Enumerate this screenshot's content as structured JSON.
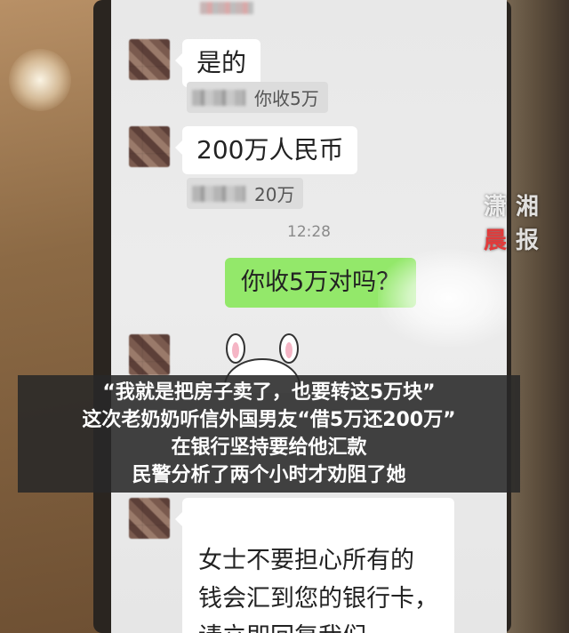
{
  "watermark": {
    "line1": [
      "潇",
      "湘"
    ],
    "line2": [
      "晨",
      "报"
    ]
  },
  "chat": {
    "messages": [
      {
        "type": "received",
        "text": "是的",
        "quote": "你收5万"
      },
      {
        "type": "received",
        "text": "200万人民币",
        "quote": "20万"
      },
      {
        "type": "timestamp",
        "text": "12:28"
      },
      {
        "type": "sent",
        "text": "你收5万对吗？"
      },
      {
        "type": "received",
        "sticker": "bunny-sticker"
      },
      {
        "type": "received",
        "text": "女士不要担心所有的\n钱会汇到您的银行卡，\n请立即回复我们"
      }
    ]
  },
  "caption": {
    "lines": [
      "“我就是把房子卖了，也要转这5万块”",
      "这次老奶奶听信外国男友“借5万还200万”",
      "在银行坚持要给他汇款",
      "民警分析了两个小时才劝阻了她"
    ]
  },
  "colors": {
    "sent_bubble": "#93e86a",
    "received_bubble": "#ffffff",
    "watermark_red": "#e23a3a",
    "caption_bg": "#282828"
  }
}
